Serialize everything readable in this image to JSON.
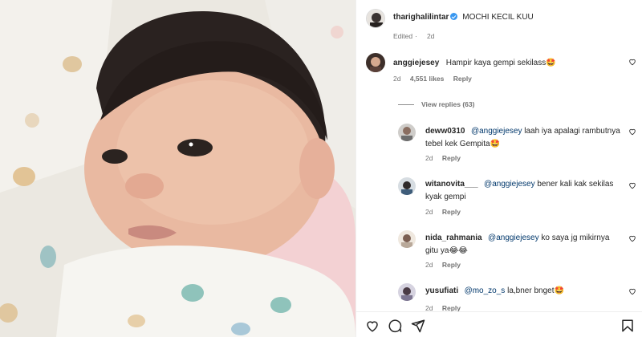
{
  "post": {
    "author": "tharighalilintar",
    "caption": "MOCHI KECIL KUU",
    "edited": "Edited",
    "age": "2d"
  },
  "comment_main": {
    "user": "anggiejesey",
    "text": "Hampir kaya gempi sekilass🤩",
    "age": "2d",
    "likes": "4,551 likes",
    "reply": "Reply",
    "view_replies": "View replies (63)"
  },
  "replies": [
    {
      "user": "deww0310",
      "mention": "@anggiejesey",
      "text": " laah iya apalagi rambutnya tebel kek Gempita🤩",
      "age": "2d",
      "reply": "Reply"
    },
    {
      "user": "witanovita___",
      "mention": "@anggiejesey",
      "text": " bener kali kak sekilas kyak gempi",
      "age": "2d",
      "reply": "Reply"
    },
    {
      "user": "nida_rahmania",
      "mention": "@anggiejesey",
      "text": " ko saya jg mikirnya gitu ya😂😂",
      "age": "2d",
      "reply": "Reply"
    },
    {
      "user": "yusufiati",
      "mention": "@mo_zo_s",
      "text": " la,bner bnget🤩",
      "age": "2d",
      "reply": "Reply"
    }
  ],
  "icons": {
    "like": "heart-icon",
    "comment": "comment-icon",
    "share": "share-icon",
    "save": "bookmark-icon"
  },
  "colors": {
    "mention": "#00376b",
    "verified": "#3897f0",
    "meta": "#737373"
  }
}
